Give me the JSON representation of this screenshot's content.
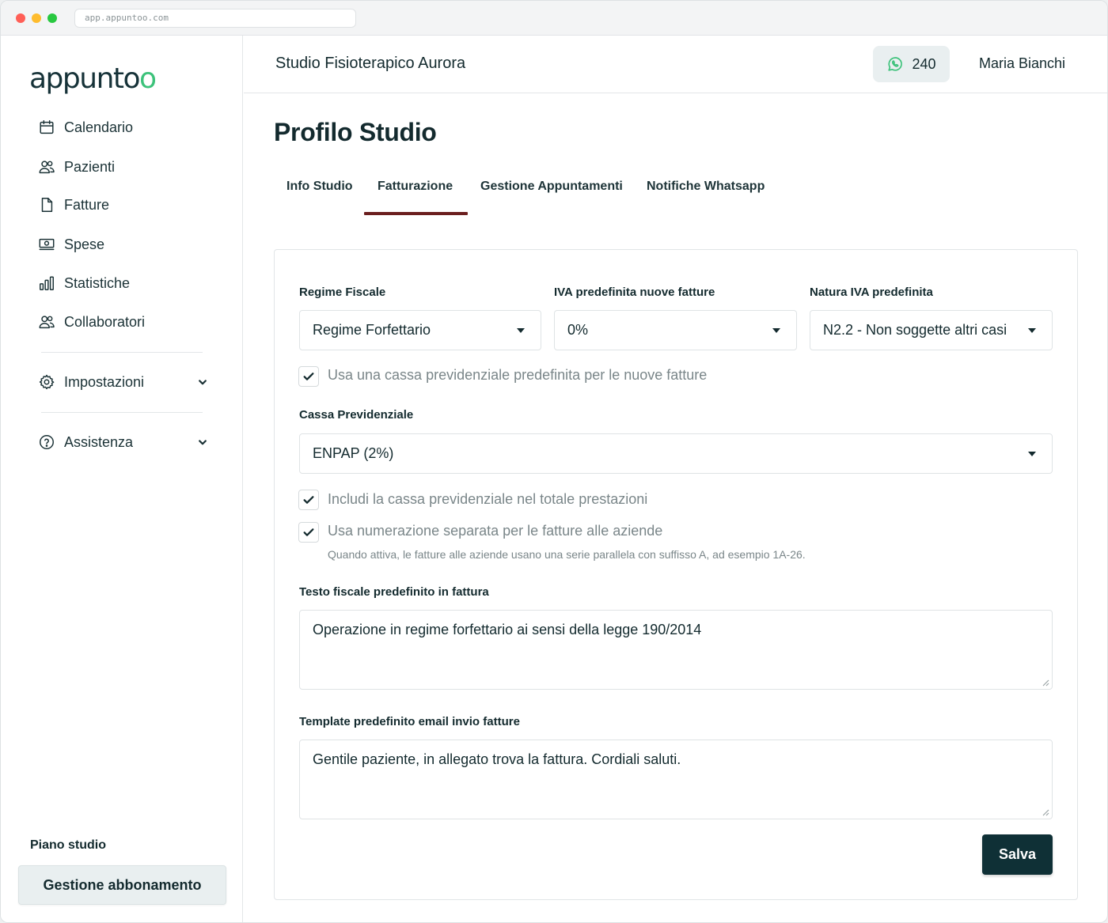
{
  "browser": {
    "url": "app.appuntoo.com"
  },
  "brand": {
    "logo_prefix": "appunt",
    "logo_o1": "o",
    "logo_o2": "o",
    "accent_color": "#3cc27a",
    "dark_color": "#0f3036",
    "tab_underline_color": "#6b1f1f"
  },
  "sidebar": {
    "items": [
      {
        "label": "Calendario",
        "icon": "calendar-icon"
      },
      {
        "label": "Pazienti",
        "icon": "users-icon"
      },
      {
        "label": "Fatture",
        "icon": "file-icon"
      },
      {
        "label": "Spese",
        "icon": "banknote-icon"
      },
      {
        "label": "Statistiche",
        "icon": "bar-chart-icon"
      },
      {
        "label": "Collaboratori",
        "icon": "users-icon"
      }
    ],
    "settings": {
      "label": "Impostazioni",
      "icon": "gear-icon"
    },
    "help": {
      "label": "Assistenza",
      "icon": "help-circle-icon"
    },
    "plan_label": "Piano studio",
    "plan_button": "Gestione abbonamento"
  },
  "header": {
    "studio_name": "Studio Fisioterapico Aurora",
    "whatsapp_count": "240",
    "user_name": "Maria Bianchi"
  },
  "main": {
    "title": "Profilo Studio",
    "tabs": [
      {
        "label": "Info Studio",
        "active": false
      },
      {
        "label": "Fatturazione",
        "active": true
      },
      {
        "label": "Gestione Appuntamenti",
        "active": false
      },
      {
        "label": "Notifiche Whatsapp",
        "active": false
      }
    ]
  },
  "form": {
    "regime_fiscale": {
      "label": "Regime Fiscale",
      "value": "Regime Forfettario"
    },
    "iva_default": {
      "label": "IVA predefinita nuove fatture",
      "value": "0%"
    },
    "natura_iva": {
      "label": "Natura IVA predefinita",
      "value": "N2.2 - Non soggette altri casi"
    },
    "use_cassa": {
      "label": "Usa una cassa previdenziale predefinita per le nuove fatture",
      "checked": true
    },
    "cassa": {
      "label": "Cassa Previdenziale",
      "value": "ENPAP (2%)"
    },
    "include_cassa": {
      "label": "Includi la cassa previdenziale nel totale prestazioni",
      "checked": true
    },
    "separate_numbering": {
      "label": "Usa numerazione separata per le fatture alle aziende",
      "checked": true,
      "hint": "Quando attiva, le fatture alle aziende usano una serie parallela con suffisso A, ad esempio 1A-26."
    },
    "testo_fiscale": {
      "label": "Testo fiscale predefinito in fattura",
      "value": "Operazione in regime forfettario ai sensi della legge 190/2014"
    },
    "email_template": {
      "label": "Template predefinito email invio fatture",
      "value": "Gentile paziente, in allegato trova la fattura. Cordiali saluti."
    },
    "save_label": "Salva"
  }
}
